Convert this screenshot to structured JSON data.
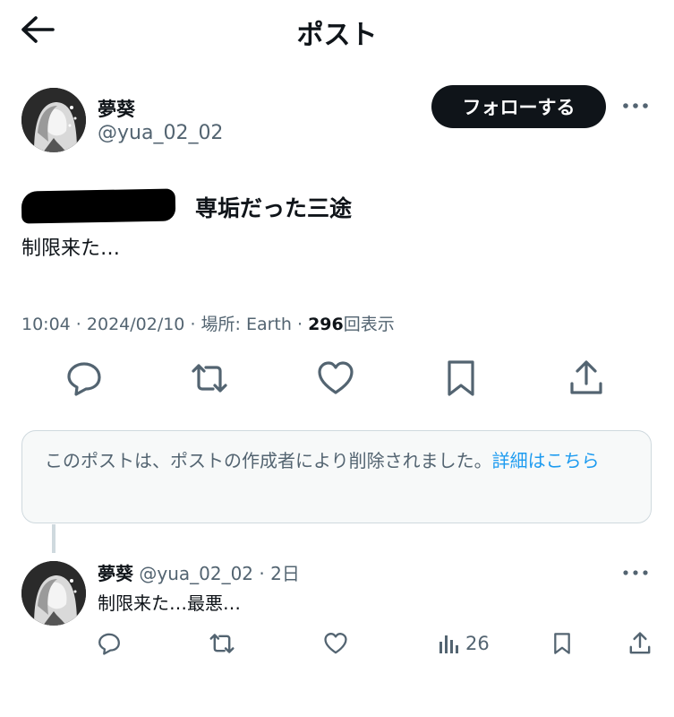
{
  "header": {
    "title": "ポスト",
    "back_icon": "arrow-left-icon"
  },
  "post": {
    "author_name": "夢葵",
    "author_handle": "@yua_02_02",
    "follow_label": "フォローする",
    "line1": "専垢だった三途",
    "line2": "制限来た…",
    "meta": {
      "time": "10:04",
      "date": "2024/02/10",
      "place_label": "場所: Earth",
      "views_count": "296",
      "views_label": "回表示"
    }
  },
  "deleted_notice": {
    "text": "このポストは、ポストの作成者により削除されました。",
    "link": "詳細はこちら"
  },
  "reply": {
    "author_name": "夢葵",
    "author_handle": "@yua_02_02",
    "time": "2日",
    "text": "制限来た…最悪…",
    "views": "26"
  },
  "colors": {
    "accent": "#1d9bf0",
    "text": "#0f1419",
    "muted": "#536471",
    "border": "#cfd9de"
  }
}
